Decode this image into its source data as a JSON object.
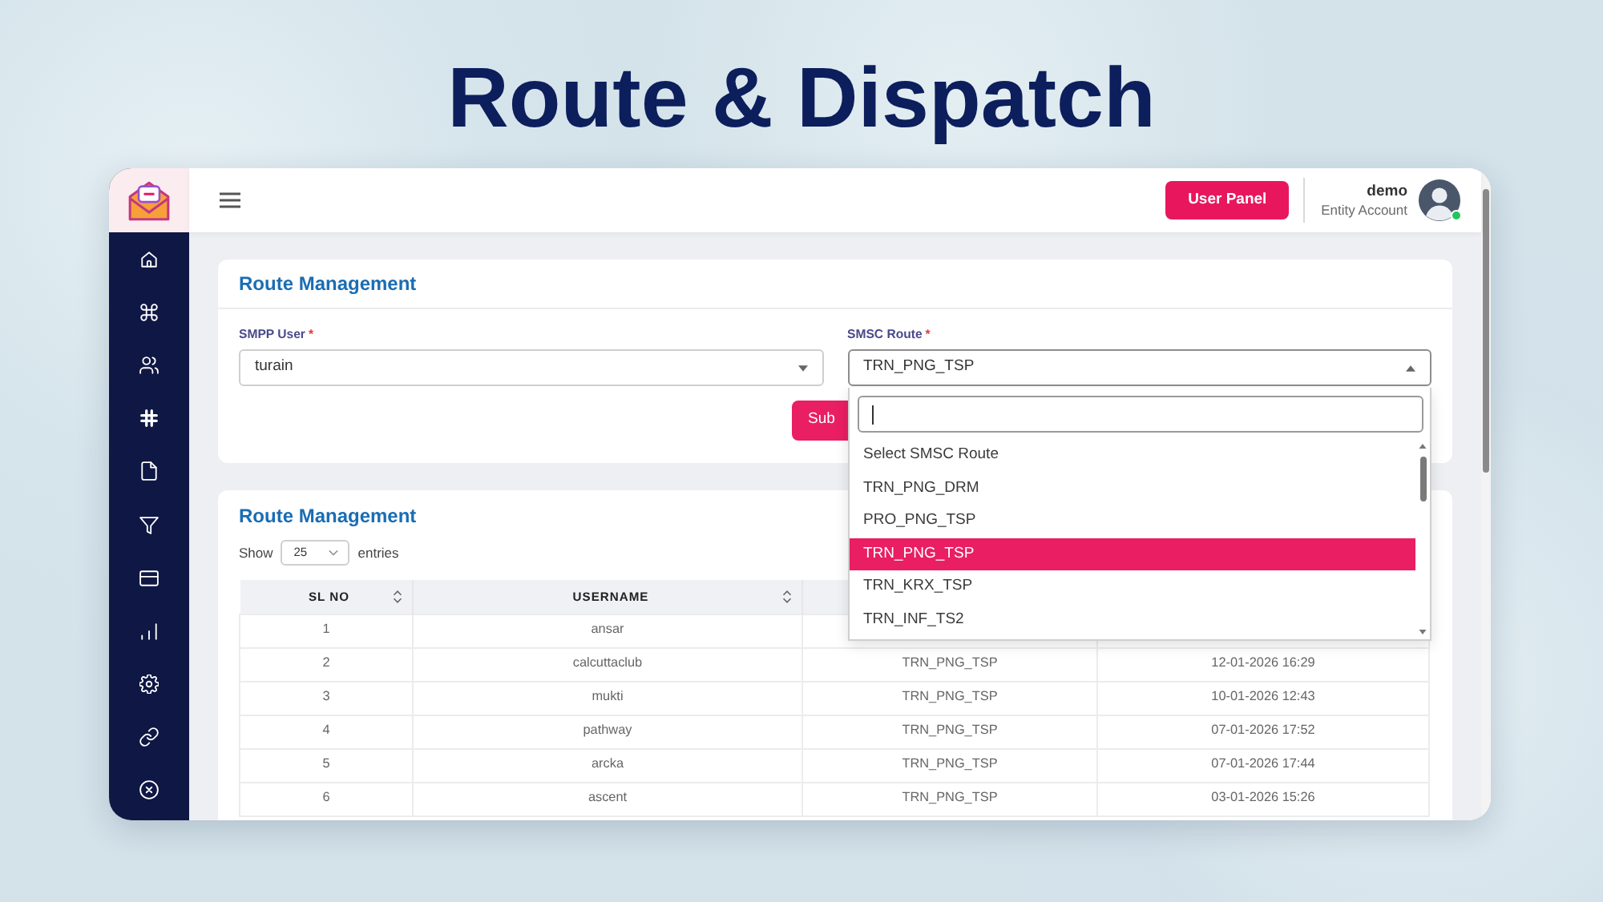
{
  "heading": {
    "title": "Route & Dispatch"
  },
  "app": {
    "sidebar": {
      "items": [
        {
          "kind": "home"
        },
        {
          "kind": "command"
        },
        {
          "kind": "users"
        },
        {
          "kind": "hashtag"
        },
        {
          "kind": "file"
        },
        {
          "kind": "filter"
        },
        {
          "kind": "card"
        },
        {
          "kind": "chart"
        },
        {
          "kind": "settings"
        },
        {
          "kind": "link"
        },
        {
          "kind": "close"
        }
      ]
    },
    "topbar": {
      "button": "User Panel",
      "user": {
        "name": "demo",
        "role": "Entity Account",
        "online": true
      }
    },
    "form": {
      "title": "Route Management",
      "fields": [
        {
          "label": "SMPP User",
          "required_mark": "*",
          "value": "turain",
          "open": false
        },
        {
          "label": "SMSC Route",
          "required_mark": "*",
          "value": "TRN_PNG_TSP",
          "open": true,
          "dropdown": {
            "search": {
              "focused": true
            },
            "options": [
              {
                "label": "Select SMSC Route",
                "selected": false
              },
              {
                "label": "TRN_PNG_DRM",
                "selected": false
              },
              {
                "label": "PRO_PNG_TSP",
                "selected": false
              },
              {
                "label": "TRN_PNG_TSP",
                "selected": true
              },
              {
                "label": "TRN_KRX_TSP",
                "selected": false
              },
              {
                "label": "TRN_INF_TS2",
                "selected": false
              }
            ]
          }
        }
      ],
      "submit": "Sub"
    },
    "table": {
      "title": "Route Management",
      "show_label": "Show",
      "page_size": "25",
      "entries_label": "entries",
      "columns": [
        {
          "label": "SL NO",
          "sortable": true
        },
        {
          "label": "USERNAME",
          "sortable": true
        }
      ],
      "rows": [
        {
          "cells": [
            "1",
            "ansar"
          ]
        },
        {
          "cells": [
            "2",
            "calcuttaclub",
            "TRN_PNG_TSP",
            "12-01-2026 16:29"
          ]
        },
        {
          "cells": [
            "3",
            "mukti",
            "TRN_PNG_TSP",
            "10-01-2026 12:43"
          ]
        },
        {
          "cells": [
            "4",
            "pathway",
            "TRN_PNG_TSP",
            "07-01-2026 17:52"
          ]
        },
        {
          "cells": [
            "5",
            "arcka",
            "TRN_PNG_TSP",
            "07-01-2026 17:44"
          ]
        },
        {
          "cells": [
            "6",
            "ascent",
            "TRN_PNG_TSP",
            "03-01-2026 15:26"
          ]
        }
      ]
    }
  }
}
